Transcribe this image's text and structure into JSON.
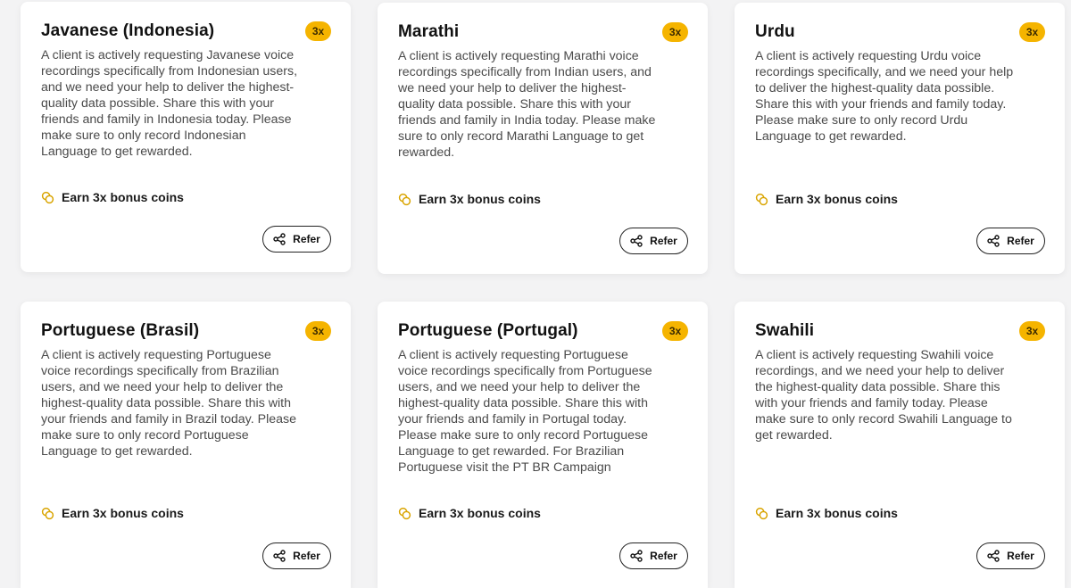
{
  "cards": [
    {
      "title": "Javanese (Indonesia)",
      "badge": "3x",
      "description": "A client is actively requesting Javanese voice recordings specifically from Indonesian users, and we need your help to deliver the highest-quality data possible. Share this with your friends and family in Indonesia today. Please make sure to only record Indonesian Language to get rewarded.",
      "earn_label": "Earn 3x bonus coins",
      "refer_label": "Refer"
    },
    {
      "title": "Marathi",
      "badge": "3x",
      "description": "A client is actively requesting Marathi voice recordings specifically from Indian users, and we need your help to deliver the highest-quality data possible. Share this with your friends and family in India today. Please make sure to only record Marathi Language to get rewarded.",
      "earn_label": "Earn 3x bonus coins",
      "refer_label": "Refer"
    },
    {
      "title": "Urdu",
      "badge": "3x",
      "description": "A client is actively requesting Urdu voice recordings specifically, and we need your help to deliver the highest-quality data possible. Share this with your friends and family today. Please make sure to only record Urdu Language to get rewarded.",
      "earn_label": "Earn 3x bonus coins",
      "refer_label": "Refer"
    },
    {
      "title": "Portuguese (Brasil)",
      "badge": "3x",
      "description": "A client is actively requesting Portuguese voice recordings specifically from Brazilian users, and we need your help to deliver the highest-quality data possible. Share this with your friends and family in Brazil today. Please make sure to only record Portuguese Language to get rewarded.",
      "earn_label": "Earn 3x bonus coins",
      "refer_label": "Refer"
    },
    {
      "title": "Portuguese (Portugal)",
      "badge": "3x",
      "description": "A client is actively requesting Portuguese voice recordings specifically from Portuguese users, and we need your help to deliver the highest-quality data possible. Share this with your friends and family in Portugal today. Please make sure to only record Portuguese Language to get rewarded. For Brazilian Portuguese visit the PT BR Campaign",
      "earn_label": "Earn 3x bonus coins",
      "refer_label": "Refer"
    },
    {
      "title": "Swahili",
      "badge": "3x",
      "description": "A client is actively requesting Swahili voice recordings, and we need your help to deliver the highest-quality data possible. Share this with your friends and family today. Please make sure to only record Swahili Language to get rewarded.",
      "earn_label": "Earn 3x bonus coins",
      "refer_label": "Refer"
    }
  ],
  "icons": {
    "earn": "coins-icon",
    "refer": "share-icon"
  },
  "colors": {
    "badge": "#f5b400",
    "coins_icon": "#d9a400",
    "background": "#f3f3f4"
  }
}
